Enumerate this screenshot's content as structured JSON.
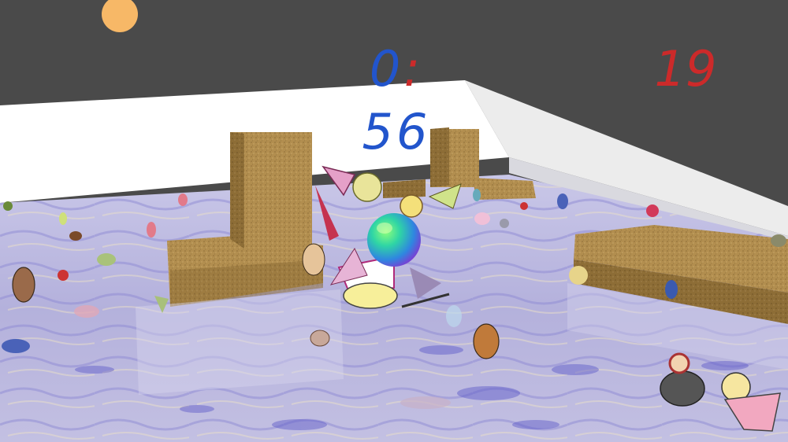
{
  "hud": {
    "timer_minutes": "0",
    "timer_separator": ":",
    "timer_seconds": "56",
    "score": "19"
  },
  "colors": {
    "timer_minutes": "#2255cc",
    "timer_separator": "#cc2a2a",
    "timer_seconds": "#2255cc",
    "score": "#cc2a2a",
    "sky": "#4a4a4a",
    "sun": "#f7b867",
    "back_wall": "#ffffff",
    "floor": "#aaa8d8",
    "crate": "#b08d4c"
  },
  "scene": {
    "sun": "sun",
    "player": "player-ball",
    "obstacles": [
      "sand-block-left",
      "sand-pillar-left",
      "sand-pillar-back",
      "sand-block-back",
      "sand-slab-right"
    ],
    "debris": [
      "drawn-doodle-sprites"
    ]
  }
}
